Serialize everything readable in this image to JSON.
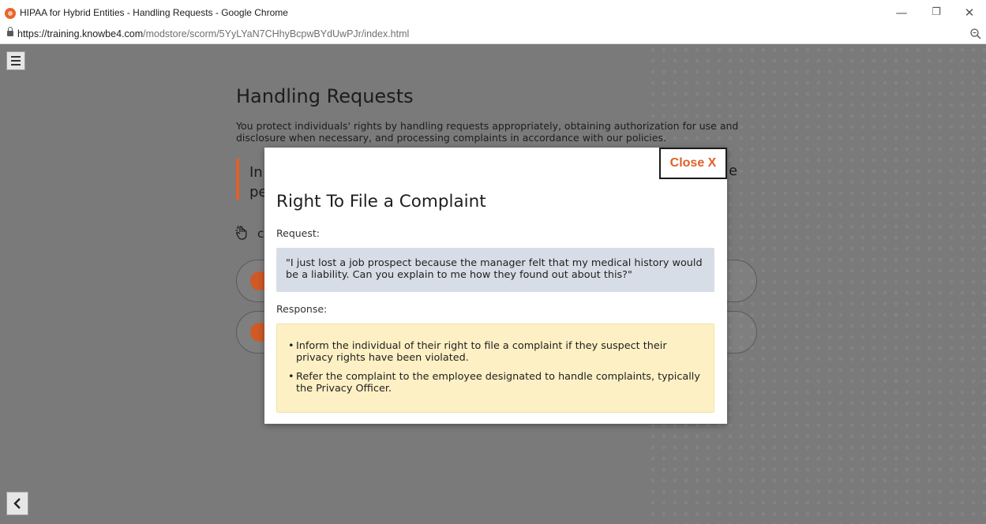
{
  "window": {
    "title": "HIPAA for Hybrid Entities - Handling Requests - Google Chrome",
    "minimize_glyph": "—",
    "maximize_glyph": "❐",
    "close_glyph": "✕"
  },
  "address_bar": {
    "url_host": "https://training.knowbe4.com",
    "url_path": "/modstore/scorm/5YyLYaN7CHhyBcpwBYdUwPJr/index.html"
  },
  "page": {
    "title": "Handling Requests",
    "description": "You protect individuals' rights by handling requests appropriately, obtaining authorization for use and disclosure when necessary, and processing complaints in accordance with our policies.",
    "callout_partial_line1": "In",
    "callout_partial_line2": "pe",
    "callout_tail": "e",
    "hand_partial": "c",
    "menu_icon": "hamburger-menu-icon",
    "back_icon": "chevron-left-icon"
  },
  "modal": {
    "close_label": "Close X",
    "title": "Right To File a Complaint",
    "request_label": "Request:",
    "request_text": "\"I just lost a job prospect because the manager felt that my medical history would be a liability. Can you explain to me how they found out about this?\"",
    "response_label": "Response:",
    "response_items": [
      "Inform the individual of their right to file a complaint if they suspect their privacy rights have been violated.",
      "Refer the complaint to the employee designated to handle complaints, typically the Privacy Officer."
    ]
  },
  "colors": {
    "accent": "#e0602a",
    "request_bg": "#d7dde6",
    "response_bg": "#fdf0c4",
    "overlay": "#7a7a7a"
  }
}
